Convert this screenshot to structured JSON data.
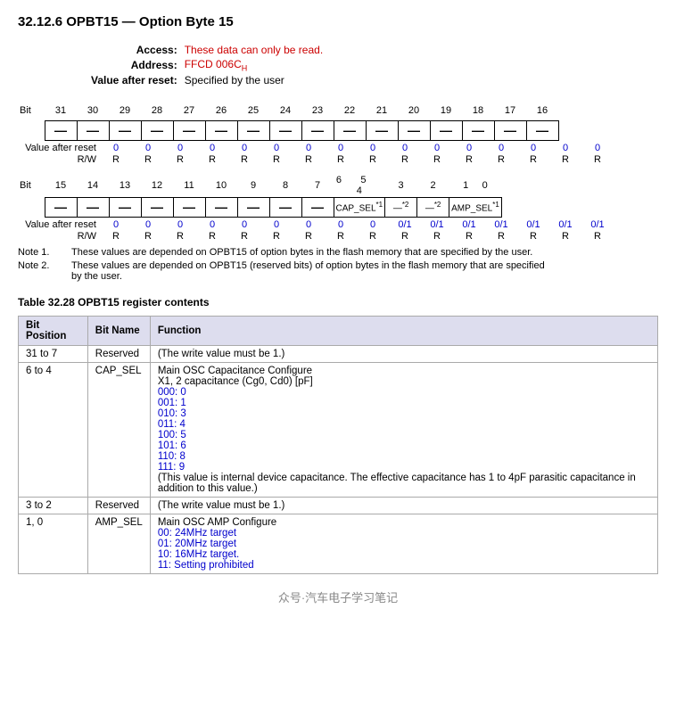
{
  "title": "32.12.6  OPBT15 — Option Byte 15",
  "access_label": "Access:",
  "access_value": "These data can only be read.",
  "address_label": "Address:",
  "address_value": "FFCD 006C",
  "address_sub": "H",
  "reset_label": "Value after reset:",
  "reset_value": "Specified by the user",
  "bits_high": {
    "header": [
      "Bit",
      "31",
      "30",
      "29",
      "28",
      "27",
      "26",
      "25",
      "24",
      "23",
      "22",
      "21",
      "20",
      "19",
      "18",
      "17",
      "16"
    ],
    "values": [
      "—",
      "—",
      "—",
      "—",
      "—",
      "—",
      "—",
      "—",
      "—",
      "—",
      "—",
      "—",
      "—",
      "—",
      "—",
      "—"
    ],
    "reset": [
      "0",
      "0",
      "0",
      "0",
      "0",
      "0",
      "0",
      "0",
      "0",
      "0",
      "0",
      "0",
      "0",
      "0",
      "0",
      "0"
    ],
    "rw": [
      "R",
      "R",
      "R",
      "R",
      "R",
      "R",
      "R",
      "R",
      "R",
      "R",
      "R",
      "R",
      "R",
      "R",
      "R",
      "R"
    ]
  },
  "bits_low": {
    "header": [
      "Bit",
      "15",
      "14",
      "13",
      "12",
      "11",
      "10",
      "9",
      "8",
      "7",
      "6",
      "5",
      "4",
      "3",
      "2",
      "1",
      "0"
    ],
    "values": [
      "—",
      "—",
      "—",
      "—",
      "—",
      "—",
      "—",
      "—",
      "—",
      "CAP_SEL*1",
      "—*2",
      "—*2",
      "AMP_SEL*1"
    ],
    "cell_spans": [
      1,
      1,
      1,
      1,
      1,
      1,
      1,
      1,
      1,
      3,
      1,
      1,
      2
    ],
    "reset": [
      "0",
      "0",
      "0",
      "0",
      "0",
      "0",
      "0",
      "0",
      "0",
      "0/1",
      "0/1",
      "0/1",
      "0/1",
      "0/1",
      "0/1",
      "0/1"
    ],
    "rw": [
      "R",
      "R",
      "R",
      "R",
      "R",
      "R",
      "R",
      "R",
      "R",
      "R",
      "R",
      "R",
      "R",
      "R",
      "R",
      "R"
    ]
  },
  "notes": [
    {
      "label": "Note 1.",
      "text": "These values are depended on OPBT15 of option bytes in the flash memory that are specified by the user."
    },
    {
      "label": "Note 2.",
      "text": "These values are depended on OPBT15 (reserved bits) of option bytes in the flash memory that are specified by the user."
    }
  ],
  "table_title": "Table 32.28   OPBT15 register contents",
  "table_headers": [
    "Bit Position",
    "Bit Name",
    "Function"
  ],
  "table_rows": [
    {
      "bit_pos": "31 to 7",
      "bit_name": "Reserved",
      "function": "(The write value must be 1.)",
      "function_extra": []
    },
    {
      "bit_pos": "6 to 4",
      "bit_name": "CAP_SEL",
      "function": "Main OSC Capacitance Configure",
      "function_extra": [
        "X1, 2 capacitance (Cg0, Cd0) [pF]",
        "000: 0",
        "001: 1",
        "010: 3",
        "011: 4",
        "100: 5",
        "101: 6",
        "110: 8",
        "111: 9",
        "(This value is internal device capacitance. The effective capacitance has 1 to 4pF parasitic capacitance in addition to this value.)"
      ],
      "function_extra_blue": [
        1,
        2,
        3,
        4,
        5,
        6,
        7,
        8
      ],
      "function_last_italic": true
    },
    {
      "bit_pos": "3 to 2",
      "bit_name": "Reserved",
      "function": "(The write value must be 1.)",
      "function_extra": []
    },
    {
      "bit_pos": "1, 0",
      "bit_name": "AMP_SEL",
      "function": "Main OSC AMP Configure",
      "function_extra": [
        "00: 24MHz target",
        "01: 20MHz target",
        "10: 16MHz target.",
        "11: Setting prohibited"
      ],
      "function_extra_blue": [
        0,
        1,
        2,
        3
      ]
    }
  ],
  "watermark": "众号·汽车电子学习笔记"
}
